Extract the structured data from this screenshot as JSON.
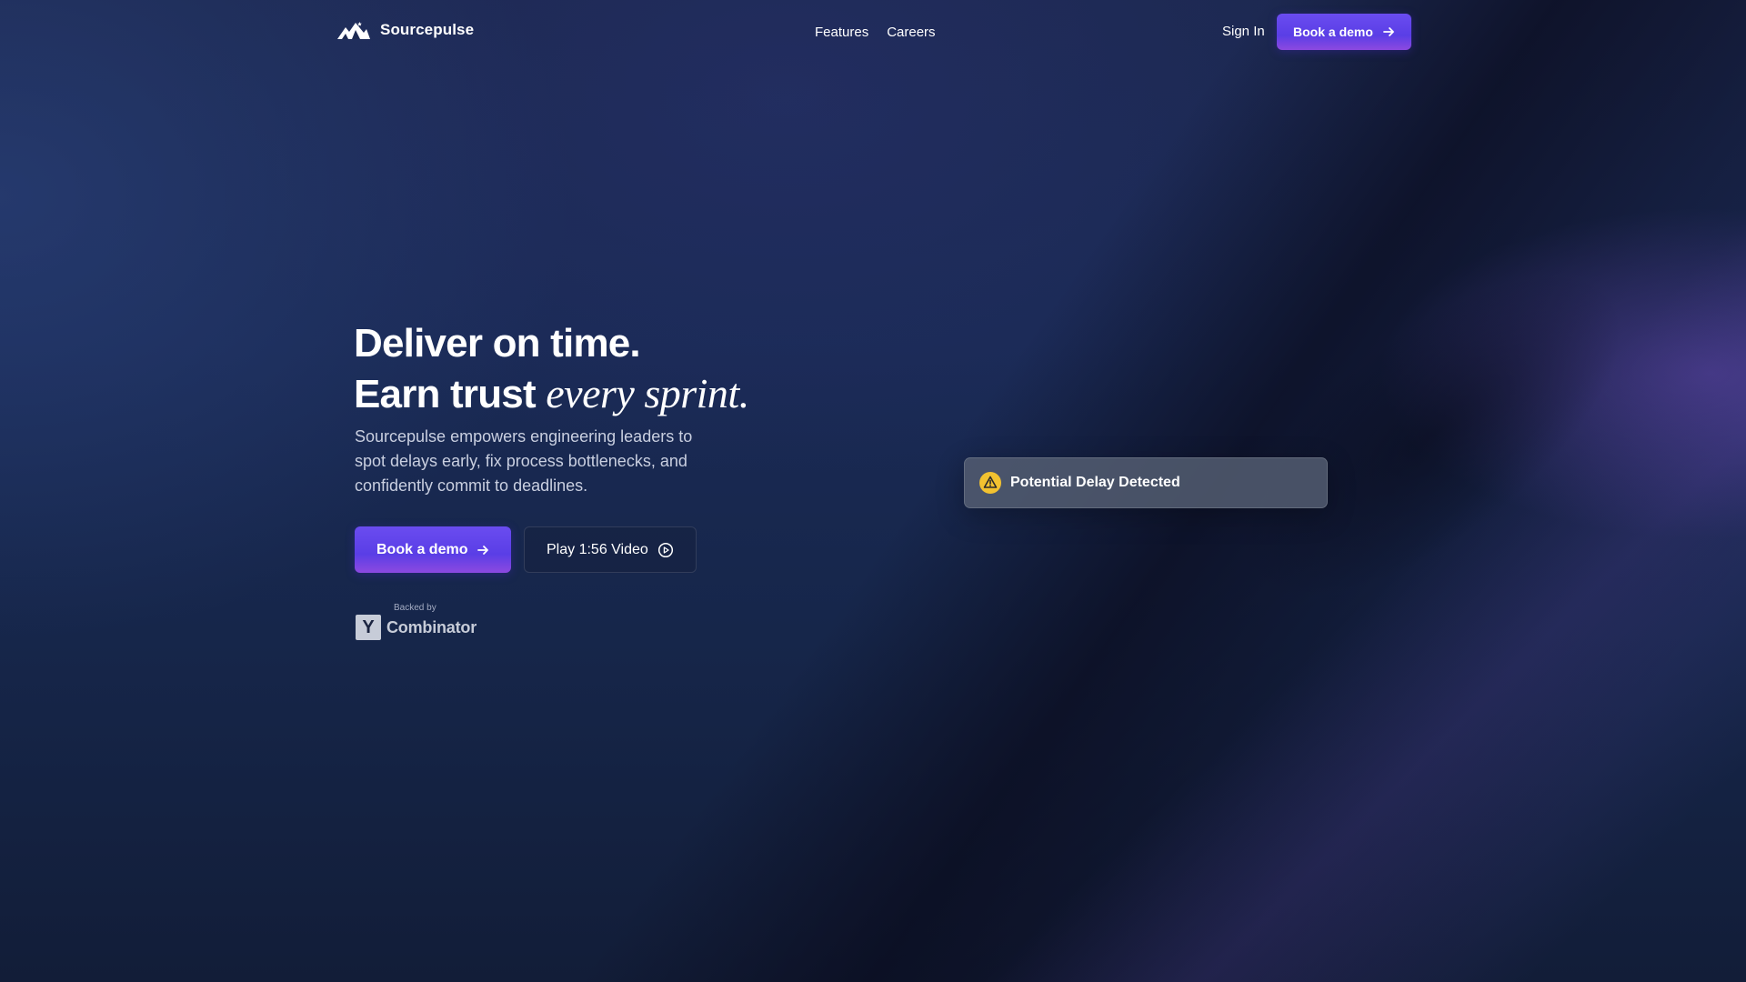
{
  "brand": {
    "name": "Sourcepulse",
    "logo_icon": "mountain-logo-icon"
  },
  "nav": {
    "links": [
      "Features",
      "Careers"
    ],
    "sign_in": "Sign In",
    "cta_label": "Book a demo"
  },
  "hero": {
    "headline_line1": "Deliver on time.",
    "headline_line2_plain": "Earn trust",
    "headline_line2_italic": "every sprint.",
    "subtext": "Sourcepulse empowers engineering leaders to spot delays early, fix process bottlenecks, and confidently commit to deadlines.",
    "primary_cta": "Book a demo",
    "video_cta": "Play 1:56 Video"
  },
  "backer": {
    "label": "Backed by",
    "letter": "Y",
    "name": "Combinator"
  },
  "alert": {
    "text": "Potential Delay Detected",
    "icon": "warning-icon"
  },
  "colors": {
    "accent": "#5b3fe8",
    "alert_yellow": "#f2c230",
    "background": "#17264a"
  }
}
